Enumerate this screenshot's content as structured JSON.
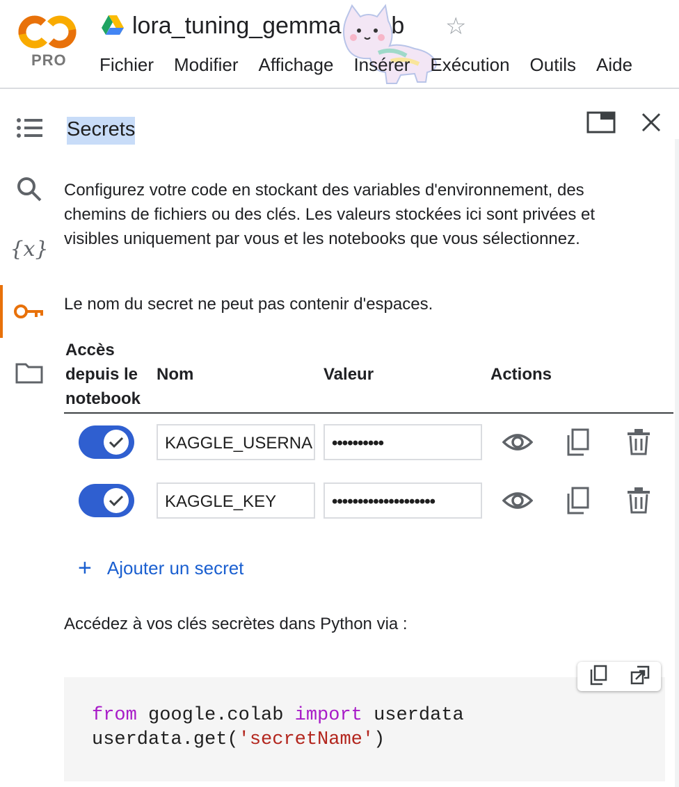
{
  "app": {
    "logo_text": "PRO",
    "notebook_title": "lora_tuning_gemma.ipynb",
    "menu": [
      "Fichier",
      "Modifier",
      "Affichage",
      "Insérer",
      "Exécution",
      "Outils",
      "Aide"
    ]
  },
  "rail": {
    "icons": [
      "table-of-contents-icon",
      "search-icon",
      "variables-icon",
      "key-icon",
      "folder-icon"
    ],
    "active": "key-icon"
  },
  "panel": {
    "title": "Secrets",
    "description": "Configurez votre code en stockant des variables d'environnement, des chemins de fichiers ou des clés. Les valeurs stockées ici sont privées et visibles uniquement par vous et les notebooks que vous sélectionnez.",
    "note": "Le nom du secret ne peut pas contenir d'espaces.",
    "columns": {
      "access_line1": "Accès",
      "access_line2": "depuis le",
      "access_line3": "notebook",
      "name": "Nom",
      "value": "Valeur",
      "actions": "Actions"
    },
    "secrets": [
      {
        "name": "KAGGLE_USERNAME",
        "value": "••••••••••",
        "access": true
      },
      {
        "name": "KAGGLE_KEY",
        "value": "••••••••••••••••••••",
        "access": true
      }
    ],
    "add_label": "Ajouter un secret",
    "access_text": "Accédez à vos clés secrètes dans Python via :",
    "code": {
      "line1_kw1": "from",
      "line1_mod": " google.colab ",
      "line1_kw2": "import",
      "line1_name": " userdata",
      "line2_call": "userdata.get(",
      "line2_str": "'secretName'",
      "line2_end": ")"
    }
  },
  "colors": {
    "accent": "#2f5fd0",
    "link": "#1a5fd0",
    "active_rail": "#e8710a",
    "title_highlight": "#c8dcf8"
  }
}
